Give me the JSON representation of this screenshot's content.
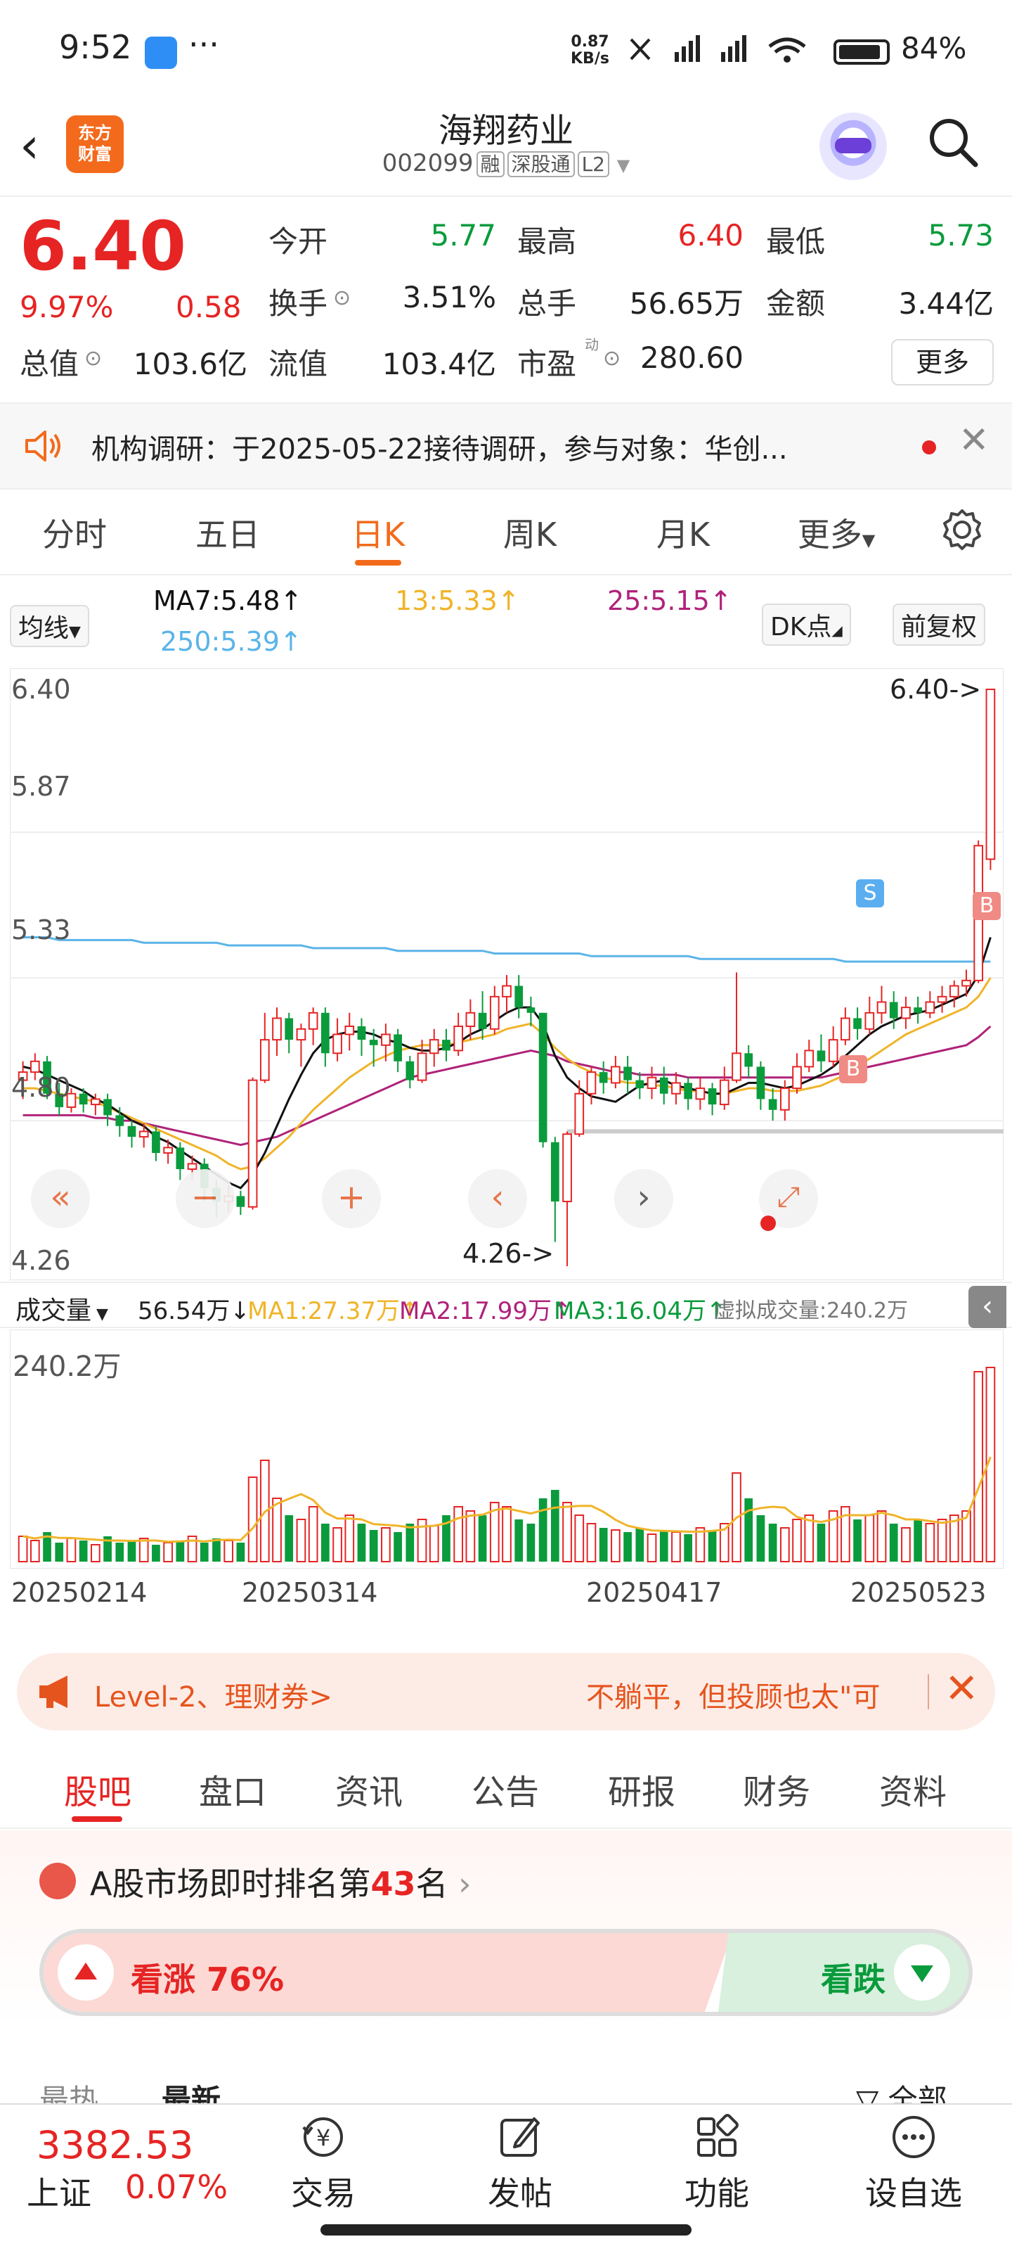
{
  "status": {
    "time": "9:52",
    "more": "···",
    "net_speed_value": "0.87",
    "net_speed_unit": "KB/s",
    "battery": "84%"
  },
  "header": {
    "back": "‹",
    "logo_line1": "东方",
    "logo_line2": "财富",
    "title": "海翔药业",
    "code": "002099",
    "tags": [
      "融",
      "深股通",
      "L2"
    ]
  },
  "quote": {
    "price": "6.40",
    "change_pct": "9.97%",
    "change": "0.58",
    "stats": [
      {
        "label": "今开",
        "value": "5.77",
        "color": "green"
      },
      {
        "label": "最高",
        "value": "6.40",
        "color": "red"
      },
      {
        "label": "最低",
        "value": "5.73",
        "color": "green"
      },
      {
        "label": "换手",
        "value": "3.51%",
        "color": "dark"
      },
      {
        "label": "总手",
        "value": "56.65万",
        "color": "dark"
      },
      {
        "label": "金额",
        "value": "3.44亿",
        "color": "dark"
      },
      {
        "label": "总值",
        "value": "103.6亿",
        "color": "dark"
      },
      {
        "label": "流值",
        "value": "103.4亿",
        "color": "dark"
      },
      {
        "label": "市盈",
        "value": "280.60",
        "color": "dark"
      }
    ],
    "pe_sup": "动",
    "more_button": "更多"
  },
  "notice": {
    "text": "机构调研：于2025-05-22接待调研，参与对象：华创..."
  },
  "chart_tabs": [
    "分时",
    "五日",
    "日K",
    "周K",
    "月K",
    "更多"
  ],
  "chart_tab_active": 2,
  "ma_legend": {
    "selector": "均线",
    "ma7": "MA7:5.48↑",
    "ma13": "13:5.33↑",
    "ma25": "25:5.15↑",
    "ma250": "250:5.39↑",
    "dk": "DK点",
    "adjust": "前复权"
  },
  "chart_data": {
    "type": "candlestick",
    "ylim": [
      4.26,
      6.4
    ],
    "y_ticks": [
      "6.40",
      "5.87",
      "5.33",
      "4.80",
      "4.26"
    ],
    "high_label": "6.40->",
    "low_label": "4.26->",
    "x_ticks": [
      "20250214",
      "20250314",
      "20250417",
      "20250523"
    ],
    "candles": [
      [
        4.95,
        4.98,
        4.88,
        5.02
      ],
      [
        4.98,
        5.02,
        4.95,
        5.05
      ],
      [
        5.02,
        4.9,
        4.88,
        5.04
      ],
      [
        4.9,
        4.85,
        4.82,
        4.94
      ],
      [
        4.85,
        4.9,
        4.83,
        4.92
      ],
      [
        4.9,
        4.86,
        4.83,
        4.92
      ],
      [
        4.86,
        4.88,
        4.82,
        4.9
      ],
      [
        4.88,
        4.82,
        4.78,
        4.9
      ],
      [
        4.82,
        4.78,
        4.74,
        4.85
      ],
      [
        4.78,
        4.74,
        4.7,
        4.8
      ],
      [
        4.74,
        4.76,
        4.7,
        4.79
      ],
      [
        4.76,
        4.68,
        4.65,
        4.78
      ],
      [
        4.68,
        4.7,
        4.64,
        4.73
      ],
      [
        4.7,
        4.62,
        4.58,
        4.72
      ],
      [
        4.62,
        4.64,
        4.58,
        4.67
      ],
      [
        4.64,
        4.55,
        4.5,
        4.66
      ],
      [
        4.55,
        4.5,
        4.44,
        4.58
      ],
      [
        4.5,
        4.52,
        4.46,
        4.56
      ],
      [
        4.52,
        4.48,
        4.45,
        4.54
      ],
      [
        4.48,
        4.95,
        4.47,
        4.96
      ],
      [
        4.95,
        5.1,
        4.94,
        5.2
      ],
      [
        5.1,
        5.18,
        5.04,
        5.22
      ],
      [
        5.18,
        5.1,
        5.05,
        5.2
      ],
      [
        5.1,
        5.14,
        5.0,
        5.16
      ],
      [
        5.14,
        5.2,
        5.08,
        5.22
      ],
      [
        5.2,
        5.05,
        5.0,
        5.22
      ],
      [
        5.05,
        5.12,
        5.02,
        5.18
      ],
      [
        5.12,
        5.15,
        5.06,
        5.2
      ],
      [
        5.15,
        5.1,
        5.04,
        5.18
      ],
      [
        5.1,
        5.08,
        5.0,
        5.14
      ],
      [
        5.08,
        5.12,
        5.02,
        5.16
      ],
      [
        5.12,
        5.02,
        4.98,
        5.14
      ],
      [
        5.02,
        4.95,
        4.92,
        5.04
      ],
      [
        4.95,
        5.05,
        4.94,
        5.1
      ],
      [
        5.05,
        5.1,
        5.0,
        5.14
      ],
      [
        5.1,
        5.06,
        5.02,
        5.14
      ],
      [
        5.06,
        5.15,
        5.04,
        5.2
      ],
      [
        5.15,
        5.2,
        5.1,
        5.25
      ],
      [
        5.2,
        5.14,
        5.1,
        5.28
      ],
      [
        5.14,
        5.26,
        5.12,
        5.3
      ],
      [
        5.26,
        5.3,
        5.2,
        5.34
      ],
      [
        5.3,
        5.22,
        5.18,
        5.34
      ],
      [
        5.22,
        5.2,
        5.15,
        5.26
      ],
      [
        5.2,
        4.72,
        4.7,
        5.2
      ],
      [
        4.72,
        4.5,
        4.35,
        4.74
      ],
      [
        4.5,
        4.75,
        4.26,
        4.76
      ],
      [
        4.75,
        4.9,
        4.74,
        4.95
      ],
      [
        4.9,
        4.98,
        4.86,
        5.0
      ],
      [
        4.98,
        4.94,
        4.9,
        5.02
      ],
      [
        4.94,
        5.0,
        4.92,
        5.04
      ],
      [
        5.0,
        4.95,
        4.9,
        5.04
      ],
      [
        4.95,
        4.92,
        4.88,
        4.98
      ],
      [
        4.92,
        4.96,
        4.88,
        5.0
      ],
      [
        4.96,
        4.9,
        4.86,
        5.0
      ],
      [
        4.9,
        4.94,
        4.86,
        4.98
      ],
      [
        4.94,
        4.88,
        4.84,
        4.96
      ],
      [
        4.88,
        4.92,
        4.84,
        4.96
      ],
      [
        4.92,
        4.86,
        4.82,
        4.94
      ],
      [
        4.86,
        4.95,
        4.84,
        5.0
      ],
      [
        4.95,
        5.05,
        4.94,
        5.35
      ],
      [
        5.05,
        5.0,
        4.96,
        5.08
      ],
      [
        5.0,
        4.88,
        4.84,
        5.02
      ],
      [
        4.88,
        4.84,
        4.8,
        4.92
      ],
      [
        4.84,
        4.92,
        4.8,
        4.95
      ],
      [
        4.92,
        5.0,
        4.9,
        5.05
      ],
      [
        5.0,
        5.06,
        4.98,
        5.1
      ],
      [
        5.06,
        5.02,
        4.98,
        5.12
      ],
      [
        5.02,
        5.1,
        5.0,
        5.15
      ],
      [
        5.1,
        5.18,
        5.08,
        5.22
      ],
      [
        5.18,
        5.14,
        5.1,
        5.22
      ],
      [
        5.14,
        5.2,
        5.12,
        5.26
      ],
      [
        5.2,
        5.24,
        5.16,
        5.3
      ],
      [
        5.24,
        5.18,
        5.14,
        5.28
      ],
      [
        5.18,
        5.22,
        5.14,
        5.26
      ],
      [
        5.22,
        5.2,
        5.16,
        5.26
      ],
      [
        5.2,
        5.24,
        5.18,
        5.28
      ],
      [
        5.24,
        5.26,
        5.2,
        5.3
      ],
      [
        5.26,
        5.3,
        5.22,
        5.32
      ],
      [
        5.3,
        5.32,
        5.26,
        5.36
      ],
      [
        5.32,
        5.82,
        5.31,
        5.84
      ],
      [
        5.77,
        6.4,
        5.73,
        6.4
      ]
    ],
    "ma7_series": [
      5.0,
      4.99,
      4.97,
      4.95,
      4.93,
      4.91,
      4.88,
      4.86,
      4.83,
      4.8,
      4.78,
      4.74,
      4.72,
      4.69,
      4.66,
      4.63,
      4.6,
      4.57,
      4.55,
      4.6,
      4.68,
      4.78,
      4.88,
      4.97,
      5.05,
      5.1,
      5.12,
      5.13,
      5.13,
      5.12,
      5.1,
      5.09,
      5.07,
      5.06,
      5.06,
      5.07,
      5.09,
      5.12,
      5.14,
      5.17,
      5.2,
      5.22,
      5.22,
      5.16,
      5.04,
      4.96,
      4.92,
      4.89,
      4.88,
      4.87,
      4.9,
      4.93,
      4.94,
      4.95,
      4.93,
      4.92,
      4.91,
      4.9,
      4.9,
      4.92,
      4.94,
      4.94,
      4.93,
      4.92,
      4.93,
      4.95,
      4.97,
      5.0,
      5.04,
      5.08,
      5.12,
      5.15,
      5.17,
      5.19,
      5.2,
      5.21,
      5.23,
      5.25,
      5.27,
      5.34,
      5.48
    ],
    "ma13_series": [
      4.92,
      4.92,
      4.91,
      4.9,
      4.89,
      4.88,
      4.87,
      4.85,
      4.83,
      4.81,
      4.79,
      4.77,
      4.75,
      4.73,
      4.71,
      4.69,
      4.67,
      4.64,
      4.62,
      4.63,
      4.66,
      4.7,
      4.74,
      4.79,
      4.84,
      4.88,
      4.92,
      4.96,
      4.99,
      5.02,
      5.04,
      5.06,
      5.07,
      5.08,
      5.08,
      5.08,
      5.09,
      5.1,
      5.11,
      5.12,
      5.14,
      5.15,
      5.16,
      5.12,
      5.07,
      5.03,
      5.0,
      4.98,
      4.96,
      4.95,
      4.94,
      4.94,
      4.93,
      4.93,
      4.92,
      4.91,
      4.91,
      4.9,
      4.9,
      4.91,
      4.92,
      4.92,
      4.91,
      4.91,
      4.91,
      4.92,
      4.93,
      4.95,
      4.97,
      5.0,
      5.03,
      5.06,
      5.09,
      5.12,
      5.14,
      5.16,
      5.18,
      5.2,
      5.22,
      5.26,
      5.33
    ],
    "ma25_series": [
      4.82,
      4.82,
      4.82,
      4.82,
      4.82,
      4.82,
      4.81,
      4.81,
      4.8,
      4.8,
      4.79,
      4.78,
      4.77,
      4.76,
      4.75,
      4.74,
      4.73,
      4.72,
      4.71,
      4.72,
      4.73,
      4.74,
      4.76,
      4.78,
      4.8,
      4.82,
      4.84,
      4.86,
      4.88,
      4.9,
      4.92,
      4.94,
      4.96,
      4.97,
      4.98,
      4.99,
      5.0,
      5.01,
      5.02,
      5.03,
      5.04,
      5.05,
      5.06,
      5.05,
      5.04,
      5.02,
      5.01,
      5.0,
      4.99,
      4.98,
      4.98,
      4.97,
      4.97,
      4.97,
      4.97,
      4.96,
      4.96,
      4.96,
      4.96,
      4.96,
      4.96,
      4.96,
      4.96,
      4.96,
      4.96,
      4.96,
      4.96,
      4.97,
      4.98,
      4.99,
      5.0,
      5.01,
      5.02,
      5.03,
      5.04,
      5.05,
      5.06,
      5.07,
      5.08,
      5.11,
      5.15
    ],
    "ma250_series": [
      5.48,
      5.48,
      5.48,
      5.47,
      5.47,
      5.47,
      5.47,
      5.47,
      5.47,
      5.47,
      5.46,
      5.46,
      5.46,
      5.46,
      5.46,
      5.46,
      5.46,
      5.45,
      5.45,
      5.45,
      5.45,
      5.45,
      5.45,
      5.45,
      5.44,
      5.44,
      5.44,
      5.44,
      5.44,
      5.44,
      5.44,
      5.43,
      5.43,
      5.43,
      5.43,
      5.43,
      5.43,
      5.43,
      5.43,
      5.42,
      5.42,
      5.42,
      5.42,
      5.42,
      5.42,
      5.42,
      5.42,
      5.41,
      5.41,
      5.41,
      5.41,
      5.41,
      5.41,
      5.41,
      5.41,
      5.41,
      5.4,
      5.4,
      5.4,
      5.4,
      5.4,
      5.4,
      5.4,
      5.4,
      5.4,
      5.4,
      5.4,
      5.4,
      5.39,
      5.39,
      5.39,
      5.39,
      5.39,
      5.39,
      5.39,
      5.39,
      5.39,
      5.39,
      5.39,
      5.39,
      5.39
    ]
  },
  "volume": {
    "selector": "成交量",
    "current": "56.54万↓",
    "ma1": "MA1:27.37万↑",
    "ma2": "MA2:17.99万↑",
    "ma3": "MA3:16.04万↑",
    "virtual": "虚拟成交量:240.2万",
    "max_label": "240.2万",
    "values": [
      12,
      10,
      14,
      9,
      11,
      10,
      8,
      12,
      9,
      10,
      11,
      8,
      9,
      10,
      12,
      9,
      11,
      10,
      9,
      40,
      48,
      30,
      22,
      20,
      26,
      18,
      16,
      22,
      18,
      15,
      16,
      14,
      18,
      20,
      17,
      22,
      26,
      24,
      22,
      28,
      26,
      20,
      18,
      30,
      34,
      28,
      22,
      18,
      16,
      15,
      14,
      16,
      13,
      15,
      14,
      13,
      16,
      15,
      18,
      42,
      30,
      22,
      18,
      16,
      20,
      22,
      18,
      24,
      26,
      20,
      22,
      24,
      18,
      16,
      20,
      18,
      20,
      22,
      24,
      90,
      92
    ]
  },
  "promo": {
    "left_text": "Level-2、理财券>",
    "right_text": "不躺平，但投顾也太\"可"
  },
  "sub_tabs": [
    "股吧",
    "盘口",
    "资讯",
    "公告",
    "研报",
    "财务",
    "资料"
  ],
  "sub_tab_active": 0,
  "ranking": {
    "prefix": "A股市场即时排名第",
    "rank": "43",
    "suffix": "名",
    "up_label": "看涨 76%",
    "down_label": "看跌",
    "sort_hot": "最热",
    "sort_new": "最新",
    "filter_all": "全部"
  },
  "bottom_bar": {
    "index_value": "3382.53",
    "index_name": "上证",
    "index_pct": "0.07%",
    "items": [
      "交易",
      "发帖",
      "功能",
      "设自选"
    ]
  },
  "colors": {
    "up": "#e62424",
    "down": "#0a9b3c",
    "accent": "#f36a1c",
    "ma7": "#111111",
    "ma13": "#f0b429",
    "ma25": "#b0227a",
    "ma250": "#5bb4e8"
  }
}
